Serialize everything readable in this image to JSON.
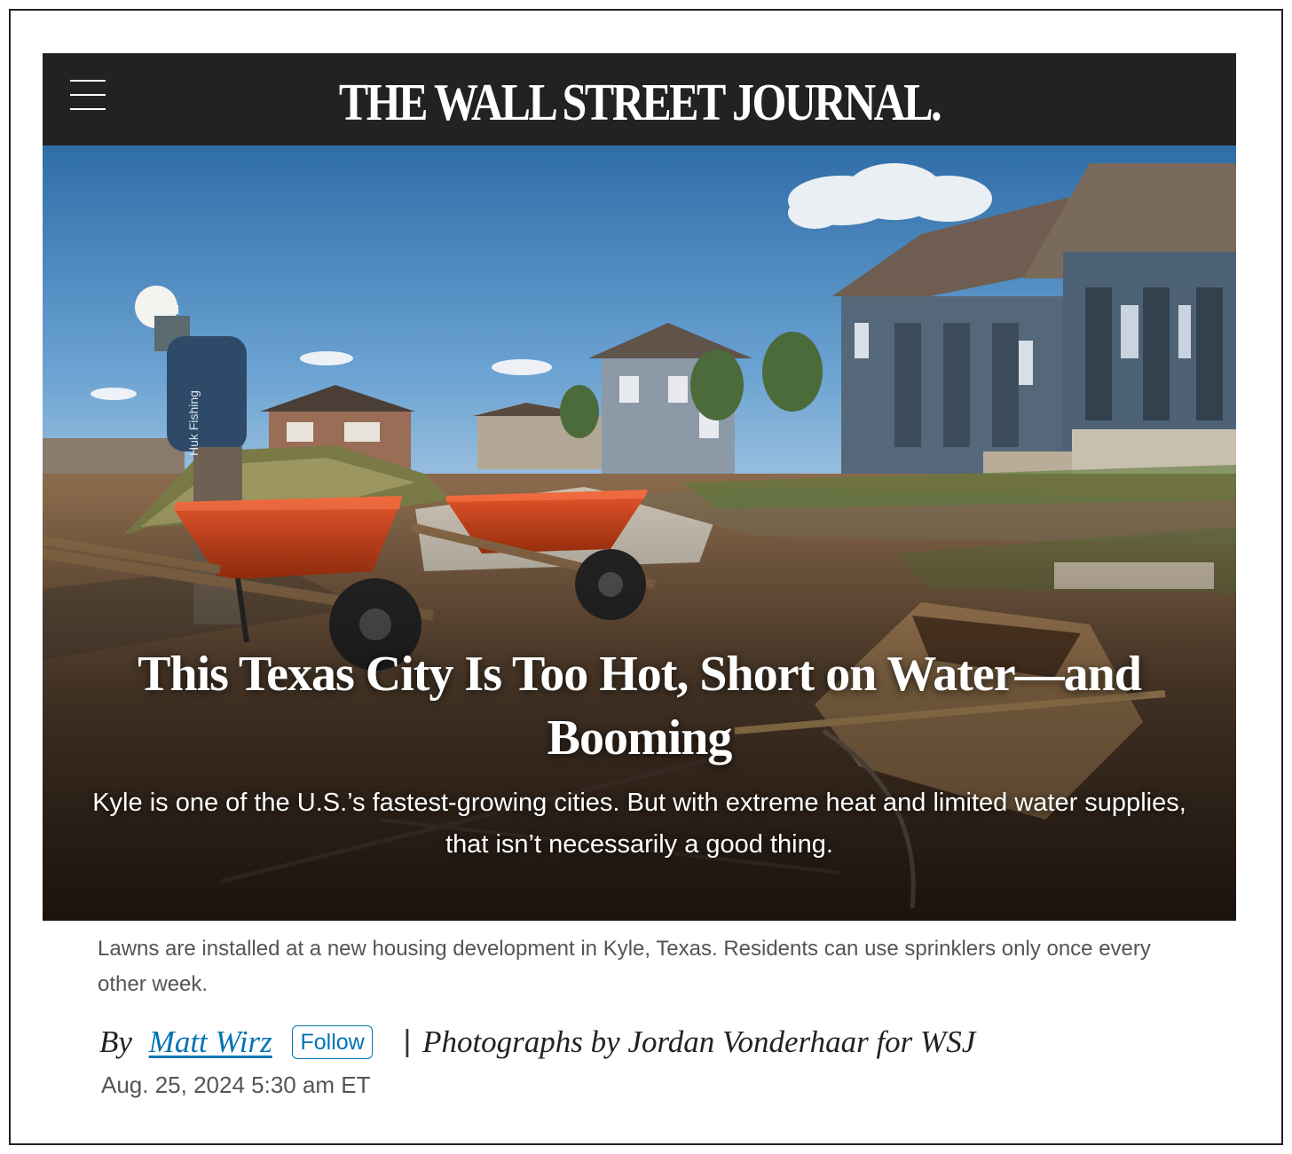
{
  "header": {
    "menu_icon": "hamburger-menu-icon",
    "brand": "THE WALL STREET JOURNAL."
  },
  "article": {
    "headline": "This Texas City Is Too Hot, Short on Water—and Booming",
    "dek": "Kyle is one of the U.S.’s fastest-growing cities. But with extreme heat and limited water supplies, that isn’t necessarily a good thing.",
    "photo_caption": "Lawns are installed at a new housing development in Kyle, Texas. Residents can use sprinklers only once every other week.",
    "byline": {
      "prefix": "By",
      "author": "Matt Wirz",
      "follow_label": "Follow",
      "separator": "|",
      "photo_credit": "Photographs by Jordan Vonderhaar for WSJ"
    },
    "timestamp": "Aug. 25, 2024 5:30 am ET"
  },
  "colors": {
    "masthead_bg": "#222222",
    "link_blue": "#0274b6",
    "caption_gray": "#555555",
    "wheelbarrow_orange": "#d5461c"
  }
}
